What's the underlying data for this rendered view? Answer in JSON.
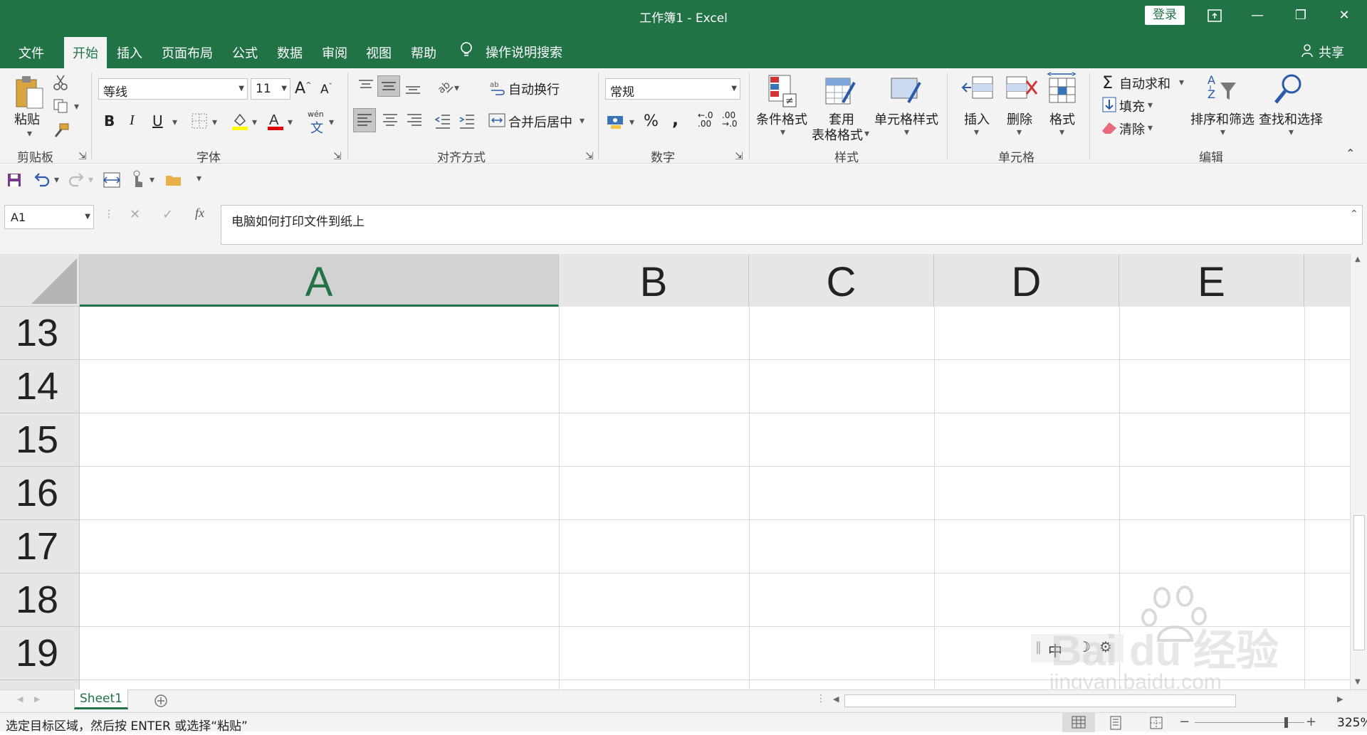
{
  "window": {
    "title": "工作簿1  -  Excel",
    "login": "登录"
  },
  "menu": {
    "items": [
      "文件",
      "开始",
      "插入",
      "页面布局",
      "公式",
      "数据",
      "审阅",
      "视图",
      "帮助"
    ],
    "active": "开始",
    "tell_me": "操作说明搜索",
    "share": "共享"
  },
  "ribbon": {
    "clipboard": {
      "paste": "粘贴",
      "label": "剪贴板"
    },
    "font": {
      "name": "等线",
      "size": "11",
      "bold": "B",
      "italic": "I",
      "underline": "U",
      "phonetic": "wén",
      "label": "字体"
    },
    "alignment": {
      "wrap": "自动换行",
      "merge": "合并后居中",
      "label": "对齐方式"
    },
    "number": {
      "format": "常规",
      "percent": "%",
      "comma": ",",
      "label": "数字"
    },
    "styles": {
      "conditional": "条件格式",
      "table_line1": "套用",
      "table_line2": "表格格式",
      "cell_styles": "单元格样式",
      "label": "样式"
    },
    "cells": {
      "insert": "插入",
      "delete": "删除",
      "format": "格式",
      "label": "单元格"
    },
    "editing": {
      "autosum": "自动求和",
      "fill": "填充",
      "clear": "清除",
      "sort": "排序和筛选",
      "find": "查找和选择",
      "label": "编辑"
    }
  },
  "formula_bar": {
    "name_box": "A1",
    "fx": "fx",
    "content": "电脑如何打印文件到纸上"
  },
  "grid": {
    "columns": [
      "A",
      "B",
      "C",
      "D",
      "E"
    ],
    "selected_column": "A",
    "rows": [
      "13",
      "14",
      "15",
      "16",
      "17",
      "18",
      "19"
    ]
  },
  "sheets": {
    "tabs": [
      "Sheet1"
    ],
    "active": "Sheet1"
  },
  "statusbar": {
    "message": "选定目标区域，然后按 ENTER 或选择“粘贴”",
    "zoom": "325%"
  },
  "watermark": {
    "brand": "Bai  du 经验",
    "url": "jingyan.baidu.com",
    "ime": "中"
  },
  "colors": {
    "accent": "#217346",
    "ribbon_bg": "#f3f3f3"
  }
}
